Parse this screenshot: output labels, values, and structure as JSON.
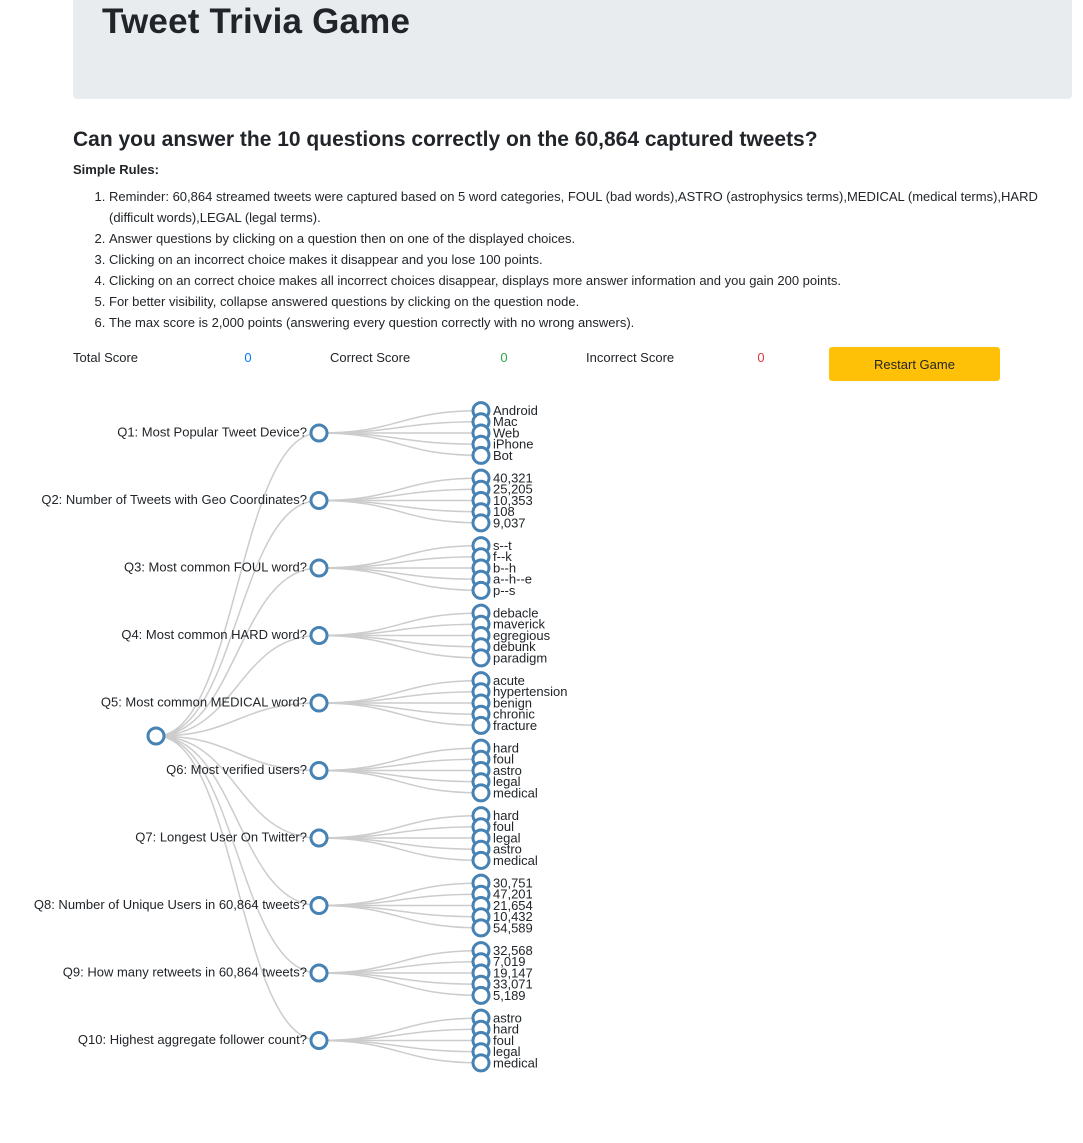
{
  "header": {
    "title": "Tweet Trivia Game"
  },
  "intro": {
    "headline": "Can you answer the 10 questions correctly on the 60,864 captured tweets?",
    "rules_heading": "Simple Rules:",
    "rules": [
      "Reminder: 60,864 streamed tweets were captured based on 5 word categories, FOUL (bad words),ASTRO (astrophysics terms),MEDICAL (medical terms),HARD (difficult words),LEGAL (legal terms).",
      "Answer questions by clicking on a question then on one of the displayed choices.",
      "Clicking on an incorrect choice makes it disappear and you lose 100 points.",
      "Clicking on an correct choice makes all incorrect choices disappear, displays more answer information and you gain 200 points.",
      "For better visibility, collapse answered questions by clicking on the question node.",
      "The max score is 2,000 points (answering every question correctly with no wrong answers)."
    ]
  },
  "scores": {
    "total_label": "Total Score",
    "total_value": "0",
    "correct_label": "Correct Score",
    "correct_value": "0",
    "incorrect_label": "Incorrect Score",
    "incorrect_value": "0",
    "restart_label": "Restart Game"
  },
  "colors": {
    "node_stroke": "#4682b4",
    "link": "#cccccc",
    "total": "#007bff",
    "correct": "#28a745",
    "incorrect": "#dc3545",
    "restart_bg": "#ffc107"
  },
  "tree": {
    "questions": [
      {
        "label": "Q1: Most Popular Tweet Device?",
        "choices": [
          "Android",
          "Mac",
          "Web",
          "iPhone",
          "Bot"
        ]
      },
      {
        "label": "Q2: Number of Tweets with Geo Coordinates?",
        "choices": [
          "40,321",
          "25,205",
          "10,353",
          "108",
          "9,037"
        ]
      },
      {
        "label": "Q3: Most common FOUL word?",
        "choices": [
          "s--t",
          "f--k",
          "b--h",
          "a--h--e",
          "p--s"
        ]
      },
      {
        "label": "Q4: Most common HARD word?",
        "choices": [
          "debacle",
          "maverick",
          "egregious",
          "debunk",
          "paradigm"
        ]
      },
      {
        "label": "Q5: Most common MEDICAL word?",
        "choices": [
          "acute",
          "hypertension",
          "benign",
          "chronic",
          "fracture"
        ]
      },
      {
        "label": "Q6: Most verified users?",
        "choices": [
          "hard",
          "foul",
          "astro",
          "legal",
          "medical"
        ]
      },
      {
        "label": "Q7: Longest User On Twitter?",
        "choices": [
          "hard",
          "foul",
          "legal",
          "astro",
          "medical"
        ]
      },
      {
        "label": "Q8: Number of Unique Users in 60,864 tweets?",
        "choices": [
          "30,751",
          "47,201",
          "21,654",
          "10,432",
          "54,589"
        ]
      },
      {
        "label": "Q9: How many retweets in 60,864 tweets?",
        "choices": [
          "32,568",
          "7,019",
          "19,147",
          "33,071",
          "5,189"
        ]
      },
      {
        "label": "Q10: Highest aggregate follower count?",
        "choices": [
          "astro",
          "hard",
          "foul",
          "legal",
          "medical"
        ]
      }
    ]
  }
}
